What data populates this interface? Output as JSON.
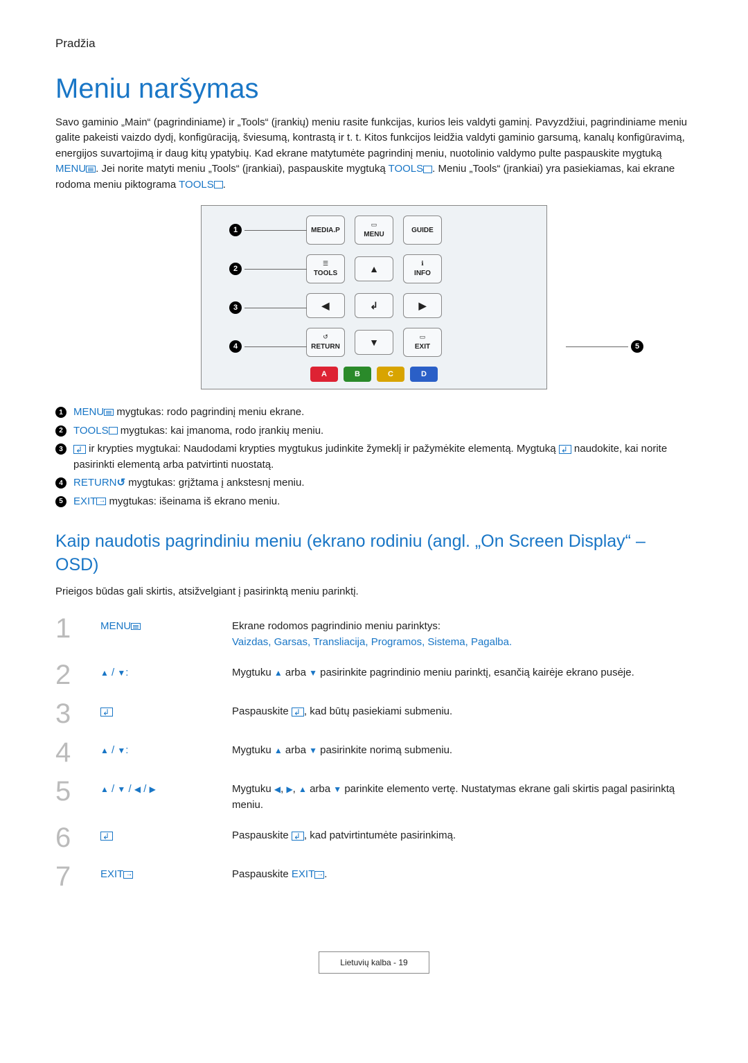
{
  "header": {
    "section": "Pradžia"
  },
  "title": "Meniu naršymas",
  "intro": {
    "p1a": "Savo gaminio „Main“ (pagrindiniame) ir „Tools“ (įrankių) meniu rasite funkcijas, kurios leis valdyti gaminį. Pavyzdžiui, pagrindiniame meniu galite pakeisti vaizdo dydį, konfigūraciją, šviesumą, kontrastą ir t. t. Kitos funkcijos leidžia valdyti gaminio garsumą, kanalų konfigūravimą, energijos suvartojimą ir daug kitų ypatybių. Kad ekrane matytumėte pagrindinį meniu, nuotolinio valdymo pulte paspauskite mygtuką ",
    "menu": "MENU",
    "p1b": ". Jei norite matyti meniu „Tools“ (įrankiai), paspauskite mygtuką ",
    "tools": "TOOLS",
    "p1c": ". Meniu „Tools“ (įrankiai) yra pasiekiamas, kai ekrane rodoma meniu piktograma ",
    "tools2": "TOOLS",
    "p1d": "."
  },
  "remote": {
    "mediap": "MEDIA.P",
    "menu": "MENU",
    "guide": "GUIDE",
    "tools": "TOOLS",
    "info": "INFO",
    "return": "RETURN",
    "exit": "EXIT",
    "a": "A",
    "b": "B",
    "c": "C",
    "d": "D"
  },
  "legend": {
    "i1": {
      "label": "MENU",
      "text": " mygtukas: rodo pagrindinį meniu ekrane."
    },
    "i2": {
      "label": "TOOLS",
      "text": " mygtukas: kai įmanoma, rodo įrankių meniu."
    },
    "i3": {
      "pre": " ir krypties mygtukai: Naudodami krypties mygtukus judinkite žymeklį ir pažymėkite elementą. Mygtuką ",
      "post": " naudokite, kai norite pasirinkti elementą arba patvirtinti nuostatą."
    },
    "i4": {
      "label": "RETURN",
      "text": " mygtukas: grįžtama į ankstesnį meniu."
    },
    "i5": {
      "label": "EXIT",
      "text": " mygtukas: išeinama iš ekrano meniu."
    }
  },
  "h2": "Kaip naudotis pagrindiniu meniu (ekrano rodiniu (angl. „On Screen Display“ – OSD)",
  "note": "Prieigos būdas gali skirtis, atsižvelgiant į pasirinktą meniu parinktį.",
  "steps": {
    "s1": {
      "key": "MENU",
      "d1": "Ekrane rodomos pagrindinio meniu parinktys:",
      "opts": [
        "Vaizdas",
        "Garsas",
        "Transliacija",
        "Programos",
        "Sistema",
        "Pagalba"
      ]
    },
    "s2": {
      "d1": "Mygtuku ",
      "d2": " arba ",
      "d3": " pasirinkite pagrindinio meniu parinktį, esančią kairėje ekrano pusėje."
    },
    "s3": {
      "d1": "Paspauskite ",
      "d2": ", kad būtų pasiekiami submeniu."
    },
    "s4": {
      "d1": "Mygtuku ",
      "d2": " arba ",
      "d3": " pasirinkite norimą submeniu."
    },
    "s5": {
      "d1": "Mygtuku ",
      "d2": ", ",
      "d3": ", ",
      "d4": " arba ",
      "d5": " parinkite elemento vertę. Nustatymas ekrane gali skirtis pagal pasirinktą meniu."
    },
    "s6": {
      "d1": "Paspauskite ",
      "d2": ", kad patvirtintumėte pasirinkimą."
    },
    "s7": {
      "key": "EXIT",
      "d1": "Paspauskite ",
      "d2": "EXIT",
      "d3": "."
    }
  },
  "footer": {
    "lang": "Lietuvių kalba",
    "page": "19"
  }
}
